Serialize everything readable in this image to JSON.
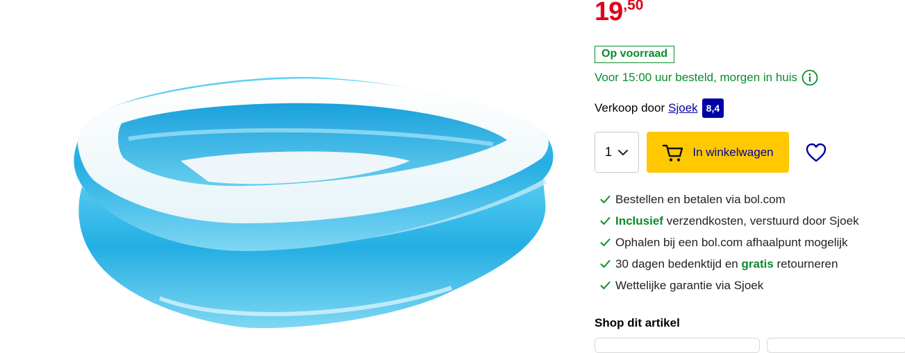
{
  "price": {
    "whole": "19",
    "cents": ",50"
  },
  "stock": {
    "label": "Op voorraad"
  },
  "delivery": {
    "text": "Voor 15:00 uur besteld, morgen in huis"
  },
  "seller": {
    "prefix": "Verkoop door",
    "name": "Sjoek",
    "rating": "8,4"
  },
  "quantity": {
    "selected": "1"
  },
  "cart_button": {
    "label": "In winkelwagen"
  },
  "usps": [
    {
      "pre": "",
      "em": "",
      "post": "Bestellen en betalen via bol.com"
    },
    {
      "pre": "",
      "em": "Inclusief",
      "post": " verzendkosten, verstuurd door Sjoek"
    },
    {
      "pre": "",
      "em": "",
      "post": "Ophalen bij een bol.com afhaalpunt mogelijk"
    },
    {
      "pre": "30 dagen bedenktijd en ",
      "em": "gratis",
      "post": " retourneren"
    },
    {
      "pre": "",
      "em": "",
      "post": "Wettelijke garantie via Sjoek"
    }
  ],
  "shop_section": {
    "title": "Shop dit artikel"
  },
  "colors": {
    "price": "#e0001b",
    "stock": "#0b8b2c",
    "brand_blue": "#0000a4",
    "cart_button": "#ffc800"
  },
  "icons": {
    "info": "info-icon",
    "cart": "cart-icon",
    "wishlist": "heart-icon",
    "check": "check-icon",
    "qty": "chevron-down-icon"
  }
}
